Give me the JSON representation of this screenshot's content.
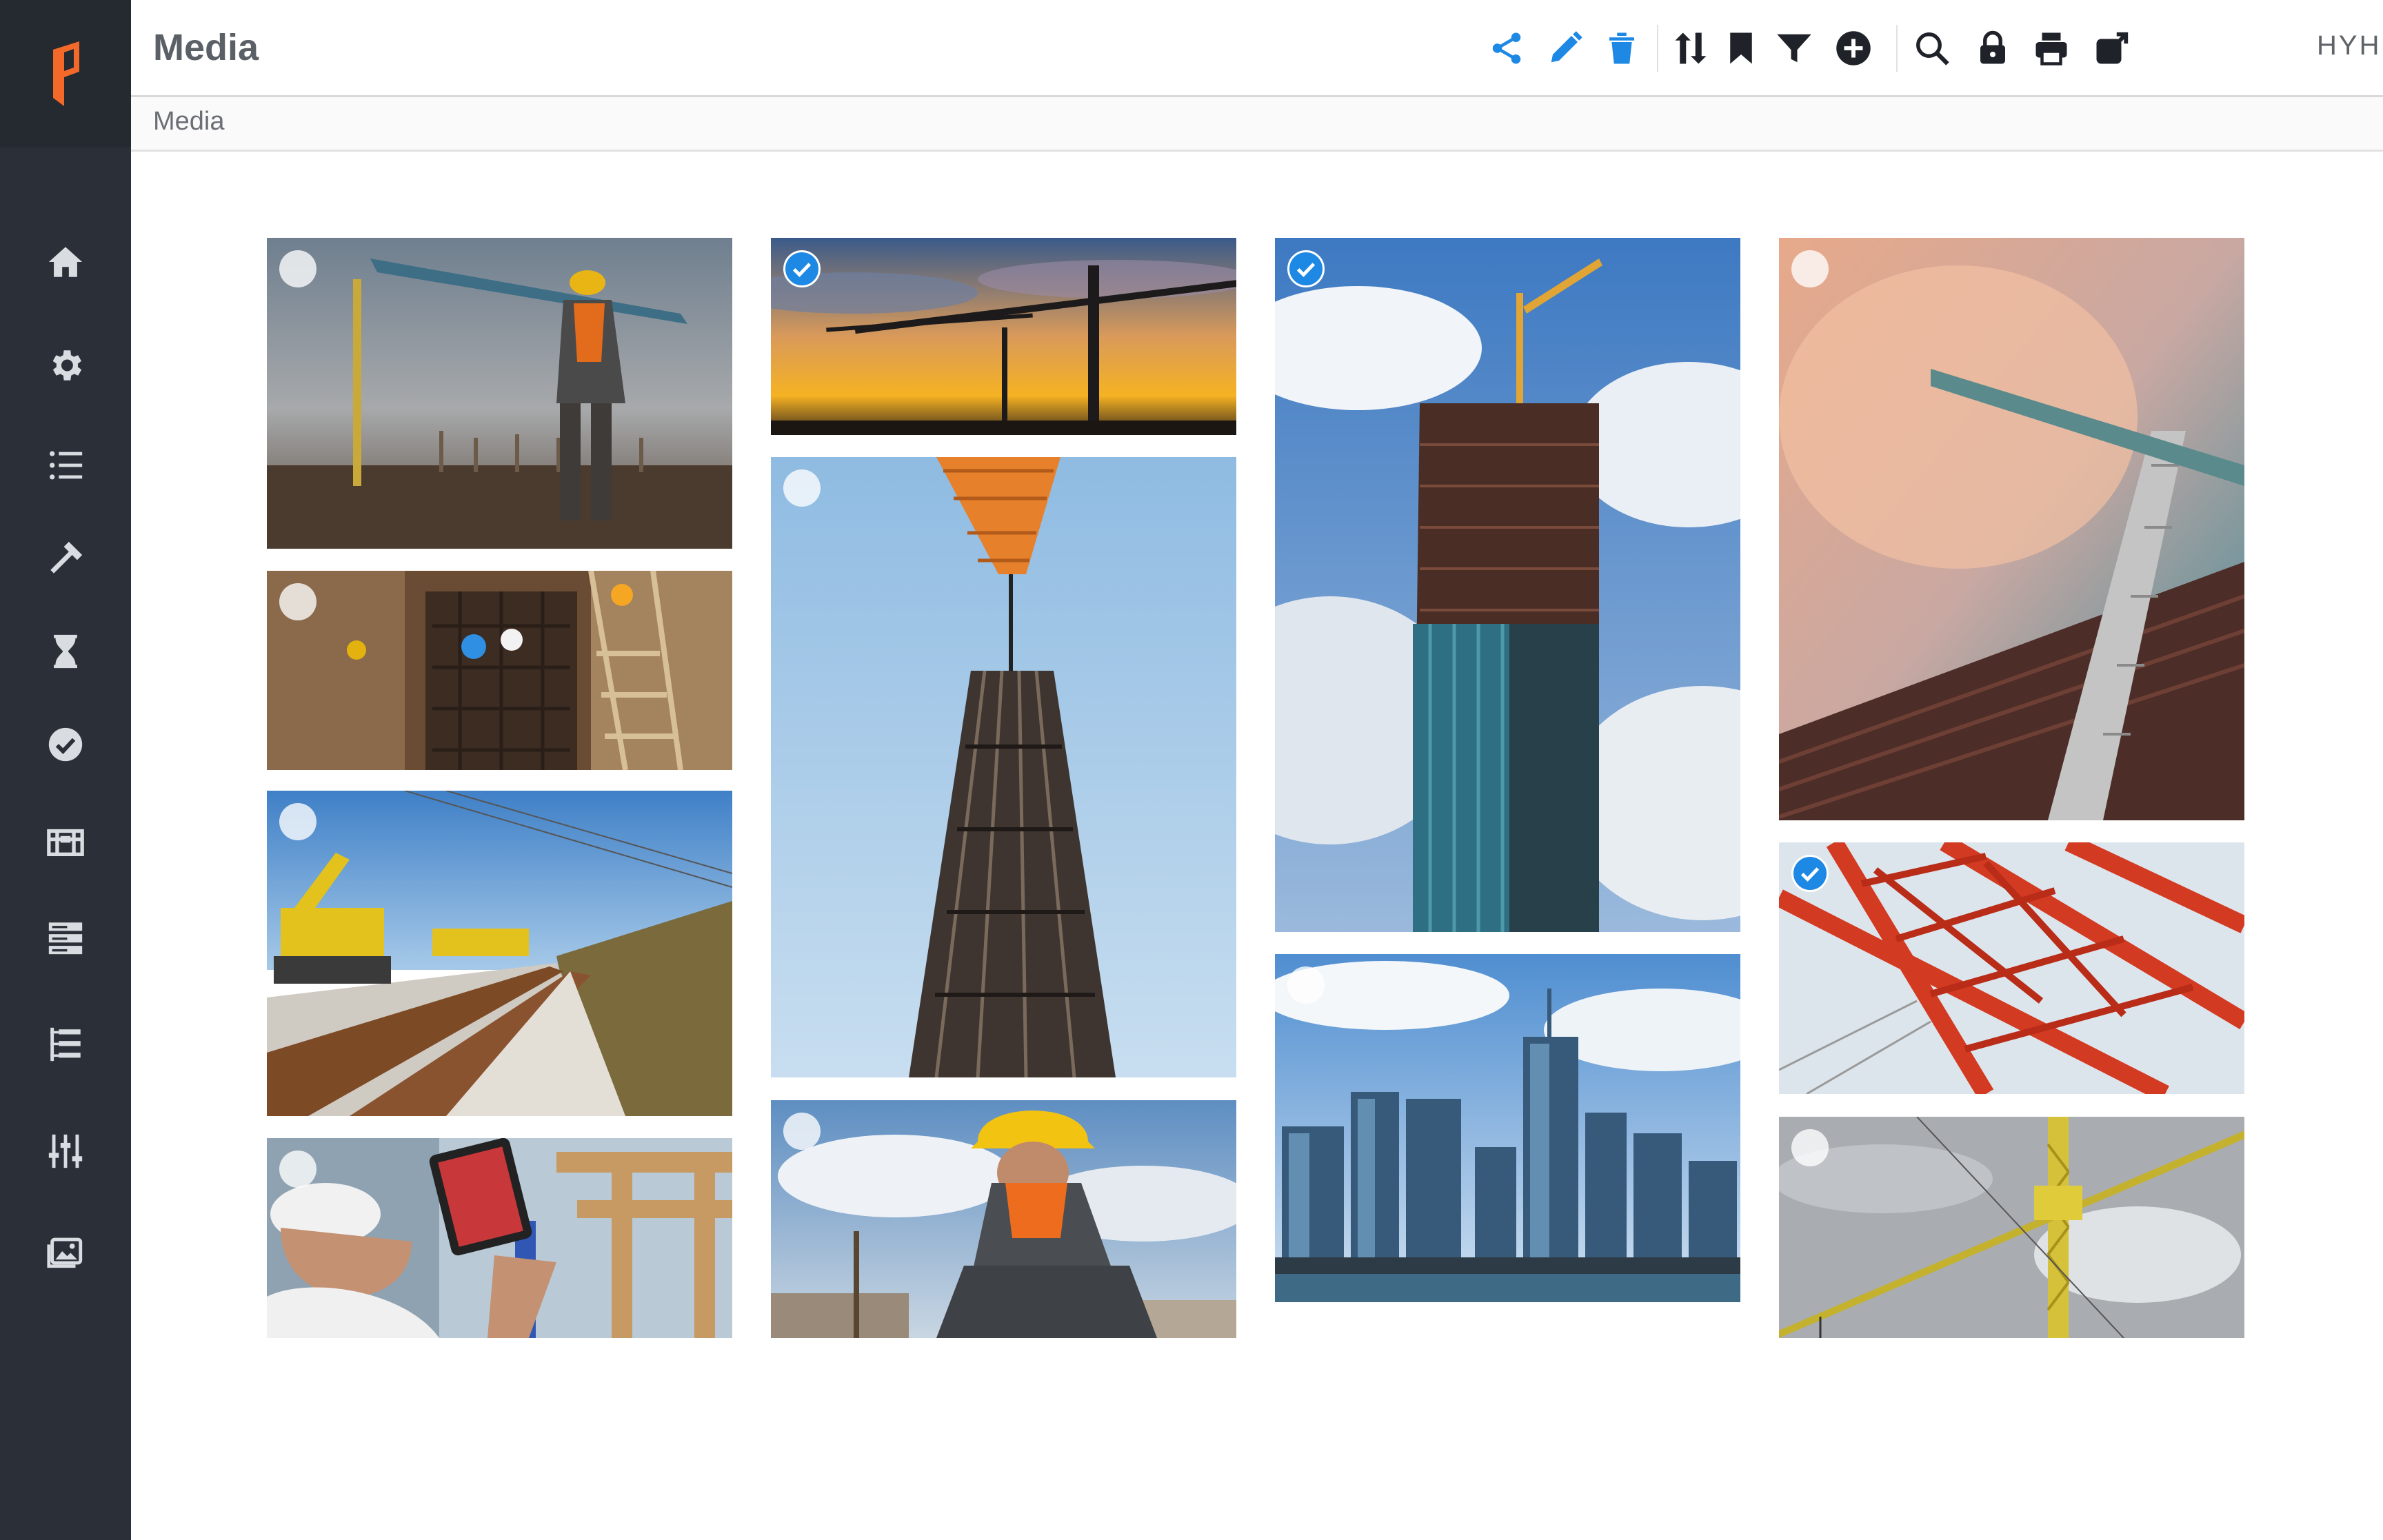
{
  "header": {
    "title": "Media",
    "user_initials": "HYH",
    "toolbar": [
      {
        "name": "share-icon",
        "color": "#1e88e5"
      },
      {
        "name": "edit-icon",
        "color": "#1e88e5"
      },
      {
        "name": "delete-icon",
        "color": "#1e88e5"
      },
      {
        "name": "sort-icon",
        "color": "#1f2329"
      },
      {
        "name": "bookmark-icon",
        "color": "#1f2329"
      },
      {
        "name": "filter-icon",
        "color": "#1f2329"
      },
      {
        "name": "add-icon",
        "color": "#1f2329"
      },
      {
        "name": "search-icon",
        "color": "#1f2329"
      },
      {
        "name": "lock-icon",
        "color": "#1f2329"
      },
      {
        "name": "print-icon",
        "color": "#1f2329"
      },
      {
        "name": "export-icon",
        "color": "#1f2329"
      }
    ]
  },
  "breadcrumb": "Media",
  "sidebar": {
    "accent": "#f2692a",
    "items": [
      "home-icon",
      "gear-icon",
      "list-icon",
      "hammer-icon",
      "hourglass-icon",
      "check-circle-icon",
      "archive-icon",
      "server-icon",
      "tree-list-icon",
      "sliders-icon",
      "gallery-icon"
    ]
  },
  "gallery": {
    "selection_color": "#1e88e5",
    "tiles": [
      {
        "col": 1,
        "selected": false,
        "subject": "workers-at-site"
      },
      {
        "col": 1,
        "selected": false,
        "subject": "stairwell-workers"
      },
      {
        "col": 1,
        "selected": false,
        "subject": "railway-excavator"
      },
      {
        "col": 1,
        "selected": false,
        "subject": "engineer-with-tablet"
      },
      {
        "col": 2,
        "selected": true,
        "subject": "crane-sunset"
      },
      {
        "col": 2,
        "selected": false,
        "subject": "rebar-cage-lift"
      },
      {
        "col": 2,
        "selected": false,
        "subject": "worker-yellow-helmet"
      },
      {
        "col": 3,
        "selected": true,
        "subject": "tower-under-construction"
      },
      {
        "col": 3,
        "selected": false,
        "subject": "city-skyline"
      },
      {
        "col": 4,
        "selected": false,
        "subject": "crane-pink-sky"
      },
      {
        "col": 4,
        "selected": true,
        "subject": "red-steel-truss"
      },
      {
        "col": 4,
        "selected": false,
        "subject": "yellow-crane"
      }
    ]
  }
}
